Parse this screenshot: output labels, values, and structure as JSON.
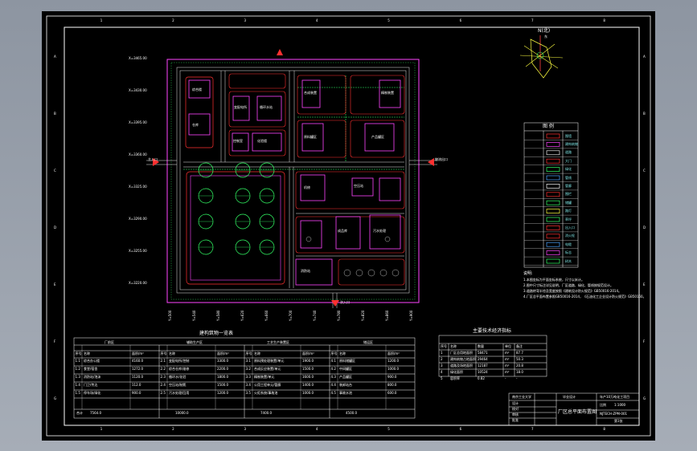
{
  "drawing": {
    "border_column_labels": [
      "1",
      "2",
      "3",
      "4",
      "5",
      "6",
      "7",
      "8"
    ],
    "border_row_labels": [
      "A",
      "B",
      "C",
      "D",
      "E",
      "F",
      "G"
    ],
    "colors": {
      "sheet": "#000000",
      "frame": "#ffffff",
      "road": "#e8e8e8",
      "building_magenta": "#ff44ff",
      "wall_red": "#ff3030",
      "plant_green": "#33ff66",
      "text": "#ffffff",
      "cyan": "#7fe6e6"
    }
  },
  "compass": {
    "label_top": "N(北)",
    "label_sub": "东"
  },
  "legend": {
    "title": "图  例",
    "items": [
      {
        "icon": "wall-line-icon",
        "label": "围墙"
      },
      {
        "icon": "building-rect-icon",
        "label": "建构筑物"
      },
      {
        "icon": "road-icon",
        "label": "道路"
      },
      {
        "icon": "gate-icon",
        "label": "大门"
      },
      {
        "icon": "plant-icon",
        "label": "绿化"
      },
      {
        "icon": "pipe-icon",
        "label": "管线"
      },
      {
        "icon": "dashed-line-icon",
        "label": "管廊"
      },
      {
        "icon": "fence-icon",
        "label": "围栏"
      },
      {
        "icon": "tank-icon",
        "label": "储罐"
      },
      {
        "icon": "lamp-icon",
        "label": "路灯"
      },
      {
        "icon": "green-rect-icon",
        "label": "草坪"
      },
      {
        "icon": "arrow-icon",
        "label": "出入口"
      },
      {
        "icon": "hydrant-icon",
        "label": "消火栓"
      },
      {
        "icon": "cable-icon",
        "label": "电缆"
      },
      {
        "icon": "flag-icon",
        "label": "标志"
      },
      {
        "icon": "tree-icon",
        "label": "树木"
      }
    ]
  },
  "notes": {
    "title": "说明:",
    "lines": [
      "1.本图坐标为平面坐标系统，尺寸以米计。",
      "2.图中尺寸标注详见说明，厂区道路、绿化、管线按规范设计。",
      "3.道路转弯半径及宽度按照《建筑设计防火规范》GB50016-2014。",
      "4.厂区总平面布置参照GB50016-2014，《石油化工企业设计防火规范》GB50160。"
    ]
  },
  "table_left": {
    "title": "建构筑物一览表",
    "groups": [
      "厂前区",
      "辅助生产区",
      "工艺生产装置区",
      "储运区"
    ],
    "headers": [
      "序号",
      "名称",
      "面积/m²",
      "序号",
      "名称",
      "面积/m²",
      "序号",
      "名称",
      "面积/m²",
      "序号",
      "名称",
      "面积/m²"
    ],
    "rows": [
      [
        "1.1",
        "综合办公楼",
        "4160.0",
        "2.1",
        "变配电所/控制",
        "3300.0",
        "3.1",
        "原料预处理装置/单元",
        "1900.0",
        "4.1",
        "原料储罐区",
        "1200.0"
      ],
      [
        "1.2",
        "食堂/宿舍",
        "1272.0",
        "2.2",
        "综合仓库/维修",
        "2200.0",
        "3.2",
        "合成反应装置/单元",
        "1500.0",
        "4.2",
        "中间罐区",
        "1000.0"
      ],
      [
        "1.3",
        "消防站/泡沫",
        "1120.0",
        "2.3",
        "循环水/化验",
        "1800.0",
        "3.3",
        "精制装置/单元",
        "1600.0",
        "4.3",
        "产品罐区",
        "900.0"
      ],
      [
        "1.4",
        "门卫/传达",
        "112.0",
        "2.4",
        "空压站/制氮",
        "1500.0",
        "3.4",
        "公用工程单元/管廊",
        "1400.0",
        "4.4",
        "装卸站台",
        "800.0"
      ],
      [
        "1.5",
        "停车场/绿化",
        "900.0",
        "2.5",
        "污水处理/回用",
        "1200.0",
        "3.5",
        "火炬系统/事故池",
        "1000.0",
        "4.5",
        "事故水池",
        "600.0"
      ]
    ],
    "totals_label": "合计",
    "totals": [
      "7564.0",
      "10000.0",
      "7400.0",
      "4500.0"
    ]
  },
  "table_right": {
    "title": "主要技术经济指标",
    "headers": [
      "序号",
      "名称",
      "数量",
      "单位",
      "备注"
    ],
    "rows": [
      [
        "1",
        "厂区总用地面积",
        "58471",
        "m²",
        "87.7"
      ],
      [
        "2",
        "建构筑物占地面积",
        "29464",
        "m²",
        "50.3"
      ],
      [
        "3",
        "道路及场地面积",
        "12187",
        "m²",
        "20.8"
      ],
      [
        "4",
        "绿化面积",
        "10524",
        "m²",
        "18.0"
      ],
      [
        "5",
        "容积率",
        "0.82",
        "-",
        "-"
      ]
    ]
  },
  "title_block": {
    "school": "南京工业大学",
    "stage": "毕业设计",
    "drawing_name": "厂区总平面布置图",
    "drawing_number": "NJTECH-ZPM-001",
    "project": "年产10万吨化工项目",
    "scale_label": "比例",
    "scale": "1:1000",
    "sheet_label": "第1张",
    "rows_left": [
      "设计",
      "校对",
      "审核",
      "批准"
    ]
  },
  "map_labels": {
    "coordinate_marks": [
      "X=3465.00",
      "X=3430.00",
      "X=3395.00",
      "X=3360.00",
      "X=3325.00",
      "X=3290.00",
      "X=3255.00",
      "X=3220.00"
    ],
    "bottom_marks": [
      "Y=500",
      "Y=540",
      "Y=580",
      "Y=620",
      "Y=660",
      "Y=700",
      "Y=740",
      "Y=780",
      "Y=820",
      "Y=860",
      "Y=900"
    ],
    "entrance_west": "主入口",
    "entrance_east": "物流出口",
    "entrance_south": "次入口",
    "buildings": [
      "综合楼",
      "仓库",
      "变配电所",
      "循环水站",
      "控制室",
      "化验楼",
      "合成装置",
      "精制装置",
      "原料罐区",
      "产品罐区",
      "机修",
      "空压站",
      "污水处理",
      "消防站",
      "成品库"
    ]
  }
}
